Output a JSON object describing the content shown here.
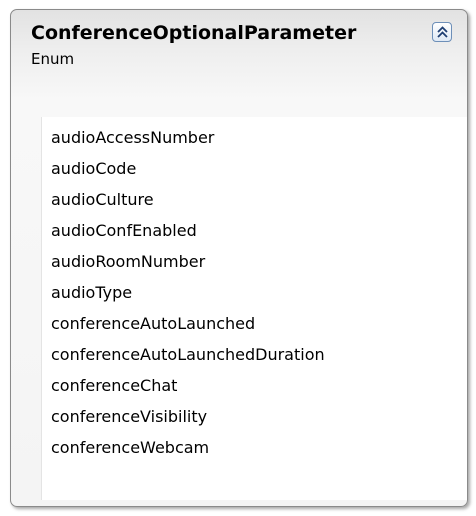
{
  "enum": {
    "name": "ConferenceOptionalParameter",
    "kind": "Enum",
    "members": [
      "audioAccessNumber",
      "audioCode",
      "audioCulture",
      "audioConfEnabled",
      "audioRoomNumber",
      "audioType",
      "conferenceAutoLaunched",
      "conferenceAutoLaunchedDuration",
      "conferenceChat",
      "conferenceVisibility",
      "conferenceWebcam"
    ]
  },
  "icons": {
    "collapse": "double-chevron-up-icon"
  }
}
